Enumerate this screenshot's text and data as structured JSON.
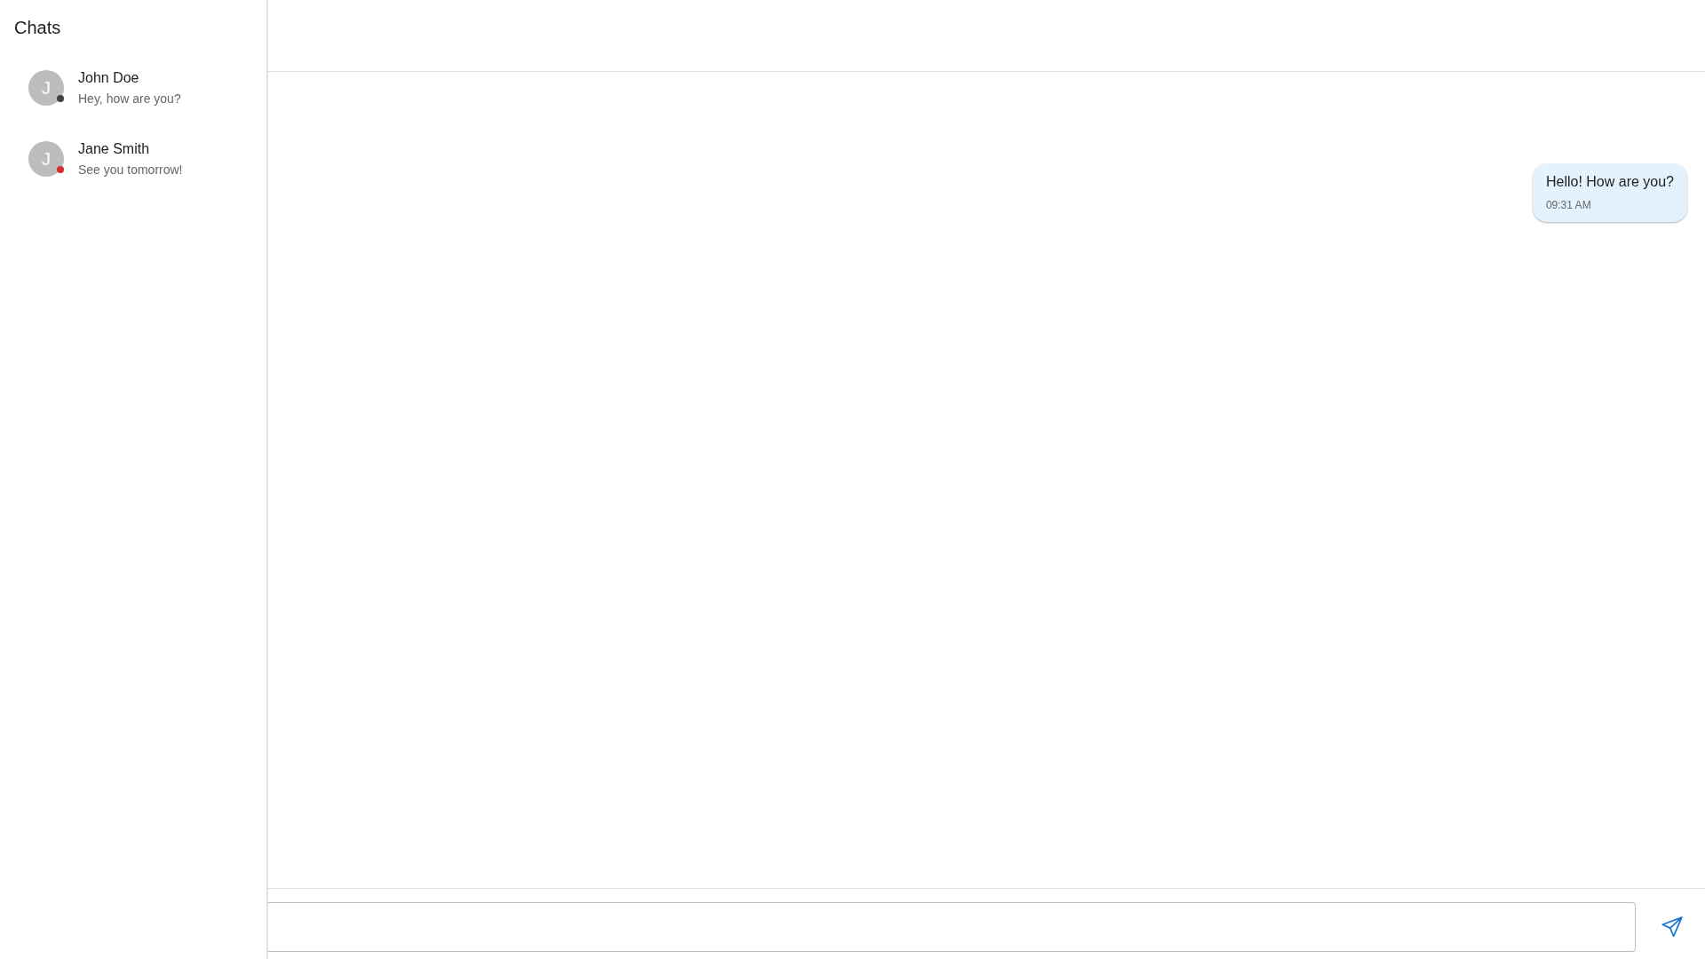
{
  "sidebar": {
    "title": "Chats",
    "chats": [
      {
        "initial": "J",
        "name": "John Doe",
        "preview": "Hey, how are you?",
        "color": "#424242"
      },
      {
        "initial": "J",
        "name": "Jane Smith",
        "preview": "See you tomorrow!",
        "color": "#d32f2f"
      }
    ]
  },
  "messages": [
    {
      "text": "Hello! How are you?",
      "time": "09:31 AM",
      "outgoing": true
    }
  ]
}
